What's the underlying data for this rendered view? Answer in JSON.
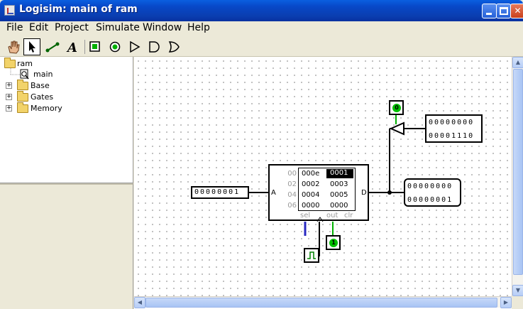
{
  "window": {
    "title": "Logisim: main of ram"
  },
  "menu": {
    "file": "File",
    "edit": "Edit",
    "project": "Project",
    "simulate": "Simulate",
    "window": "Window",
    "help": "Help"
  },
  "explorer": {
    "root": "ram",
    "circuit": "main",
    "folders": [
      "Base",
      "Gates",
      "Memory"
    ]
  },
  "circuit": {
    "input_pin_value": "00000001",
    "output_pin_value": [
      "00000000",
      "00000001"
    ],
    "tristate_input_value": [
      "00000000",
      "00001110"
    ],
    "enable_value": "0",
    "clear_value": "1",
    "ram": {
      "port_a": "A",
      "port_d": "D",
      "port_sel": "sel",
      "port_out": "out",
      "port_clr": "clr",
      "rows": [
        {
          "addr": "00",
          "c0": "000e",
          "c1": "0001"
        },
        {
          "addr": "02",
          "c0": "0002",
          "c1": "0003"
        },
        {
          "addr": "04",
          "c0": "0004",
          "c1": "0005"
        },
        {
          "addr": "06",
          "c0": "0000",
          "c1": "0000"
        }
      ]
    }
  }
}
